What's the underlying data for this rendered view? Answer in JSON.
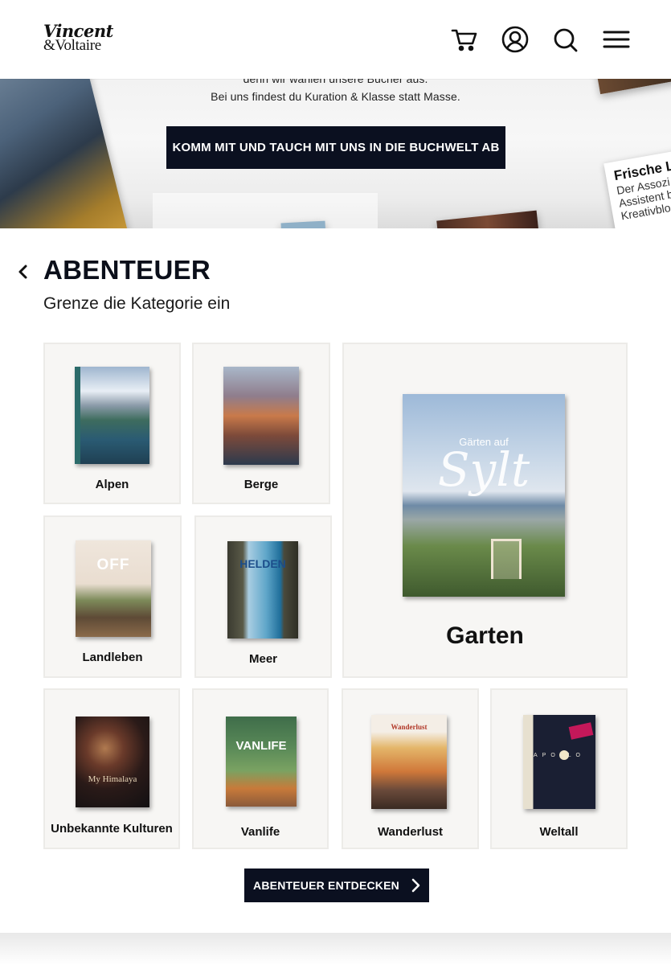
{
  "header": {
    "logo_line1": "Vincent",
    "logo_line2": "&Voltaire",
    "icons": [
      "cart-icon",
      "account-icon",
      "search-icon",
      "menu-icon"
    ]
  },
  "hero": {
    "line_partial": "denn wir wählen unsere Bücher aus.",
    "line_full": "Bei uns findest du Kuration & Klasse statt Masse.",
    "cta_label": "KOMM MIT UND TAUCH MIT UNS IN DIE BUCHWELT AB",
    "note_title": "Frische L",
    "note_lines": [
      "Der Assozi",
      "Assistent b",
      "Kreativblo"
    ]
  },
  "category": {
    "title": "ABENTEUER",
    "subtitle": "Grenze die Kategorie ein",
    "tiles": [
      {
        "label": "Alpen"
      },
      {
        "label": "Berge"
      },
      {
        "label": "Garten",
        "cover_title": "Gärten auf",
        "cover_script": "Sylt"
      },
      {
        "label": "Landleben",
        "cover_title": "OFF"
      },
      {
        "label": "Meer",
        "cover_title": "HELDEN"
      },
      {
        "label": "Unbekannte Kulturen",
        "cover_title": "My Himalaya"
      },
      {
        "label": "Vanlife",
        "cover_title": "VANLIFE"
      },
      {
        "label": "Wanderlust",
        "cover_title": "Wanderlust"
      },
      {
        "label": "Weltall",
        "cover_title": "APOLLO"
      }
    ],
    "explore_label": "ABENTEUER ENTDECKEN"
  },
  "colors": {
    "primary_dark": "#0b1020",
    "tile_bg": "#f7f6f4",
    "text": "#0b0f1a"
  }
}
